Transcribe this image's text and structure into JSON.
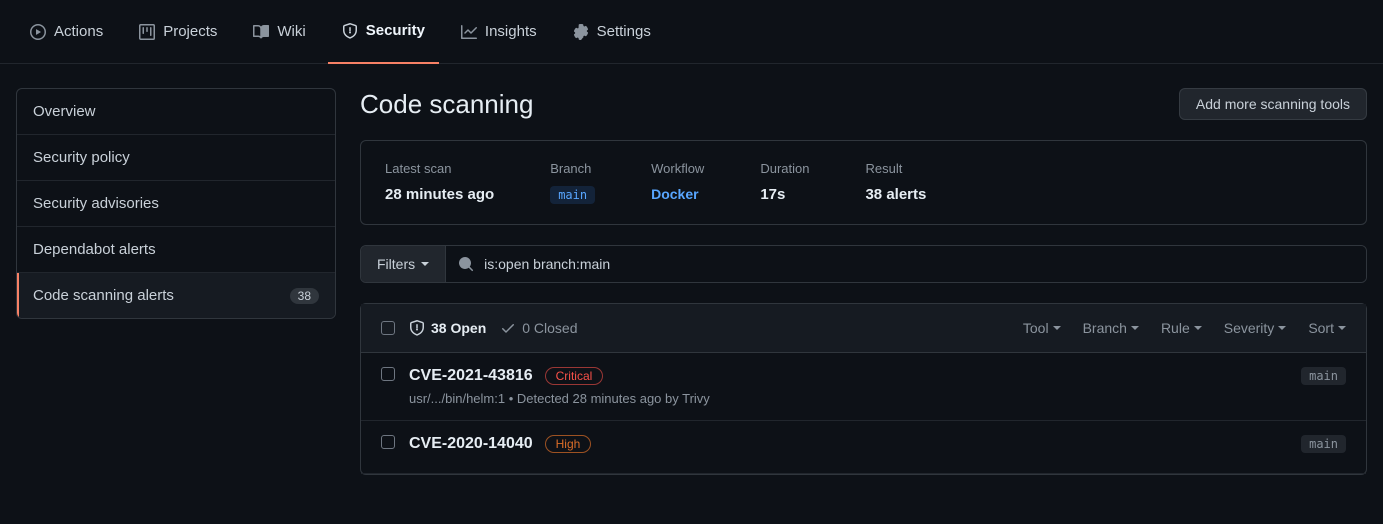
{
  "topnav": {
    "actions": "Actions",
    "projects": "Projects",
    "wiki": "Wiki",
    "security": "Security",
    "insights": "Insights",
    "settings": "Settings"
  },
  "sidebar": {
    "overview": "Overview",
    "security_policy": "Security policy",
    "security_advisories": "Security advisories",
    "dependabot_alerts": "Dependabot alerts",
    "code_scanning_alerts": "Code scanning alerts",
    "code_scanning_count": "38"
  },
  "page": {
    "title": "Code scanning",
    "add_tools_btn": "Add more scanning tools"
  },
  "summary": {
    "latest_scan_label": "Latest scan",
    "latest_scan_value": "28 minutes ago",
    "branch_label": "Branch",
    "branch_value": "main",
    "workflow_label": "Workflow",
    "workflow_value": "Docker",
    "duration_label": "Duration",
    "duration_value": "17s",
    "result_label": "Result",
    "result_value": "38 alerts"
  },
  "filter": {
    "filters_btn": "Filters",
    "search_value": "is:open branch:main"
  },
  "list_header": {
    "open": "38 Open",
    "closed": "0 Closed",
    "tool": "Tool",
    "branch": "Branch",
    "rule": "Rule",
    "severity": "Severity",
    "sort": "Sort"
  },
  "alerts": [
    {
      "title": "CVE-2021-43816",
      "severity": "Critical",
      "sev_class": "sev-critical",
      "sub": "usr/.../bin/helm:1 • Detected 28 minutes ago by Trivy",
      "branch": "main"
    },
    {
      "title": "CVE-2020-14040",
      "severity": "High",
      "sev_class": "sev-high",
      "sub": "",
      "branch": "main"
    }
  ]
}
